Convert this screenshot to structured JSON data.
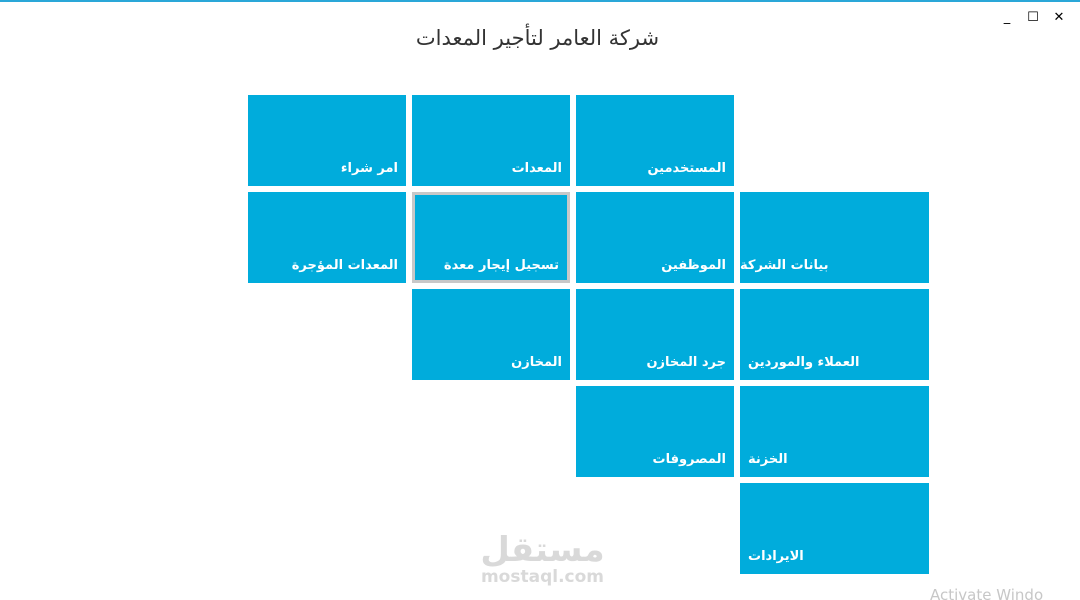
{
  "window": {
    "title": "شركة العامر لتأجير المعدات",
    "minimize_glyph": "_",
    "maximize_glyph": "☐",
    "close_glyph": "✕"
  },
  "tiles": {
    "purchase_order": "امر شراء",
    "equipment": "المعدات",
    "users": "المستخدمين",
    "rented_equipment": "المعدات المؤجرة",
    "register_rental": "تسجيل إيجار معدة",
    "employees": "الموظفين",
    "company_data": "بيانات الشركة",
    "warehouses": "المخازن",
    "inventory": "جرد المخازن",
    "clients_suppliers": "العملاء والموردين",
    "expenses": "المصروفات",
    "treasury": "الخزنة",
    "revenues": "الايرادات"
  },
  "watermark": {
    "arabic": "مستقل",
    "latin": "mostaql.com"
  },
  "os_overlay": {
    "activate_text": "Activate Windo"
  },
  "colors": {
    "tile": "#00acdc",
    "selected_border": "#c8c8c8"
  }
}
